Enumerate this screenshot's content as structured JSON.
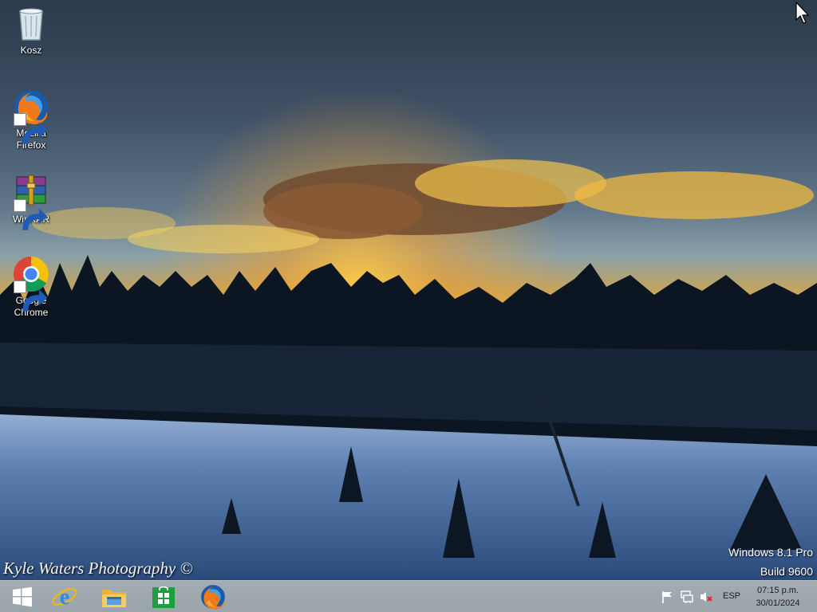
{
  "desktop": {
    "icons": [
      {
        "label": "Kosz",
        "icon": "recycle-bin-icon"
      },
      {
        "label": "Mozilla Firefox",
        "icon": "firefox-icon",
        "shortcut": true
      },
      {
        "label": "WinRAR",
        "icon": "winrar-icon",
        "shortcut": true
      },
      {
        "label": "Google Chrome",
        "icon": "chrome-icon",
        "shortcut": true
      }
    ],
    "watermark": {
      "edition": "Windows 8.1 Pro",
      "build": "Build 9600"
    },
    "photo_credit": "Kyle Waters Photography ©"
  },
  "taskbar": {
    "start_icon": "windows-start-icon",
    "pinned": [
      {
        "name": "Internet Explorer",
        "icon": "internet-explorer-icon"
      },
      {
        "name": "File Explorer",
        "icon": "file-explorer-icon"
      },
      {
        "name": "Store",
        "icon": "store-icon"
      },
      {
        "name": "Mozilla Firefox",
        "icon": "firefox-icon"
      }
    ],
    "tray": {
      "icons": [
        "action-center-flag-icon",
        "network-icon",
        "volume-muted-icon"
      ],
      "language": "ESP",
      "time": "07:15 p.m.",
      "date": "30/01/2024"
    },
    "colors": {
      "taskbar_bg": "#9ea8af"
    }
  }
}
